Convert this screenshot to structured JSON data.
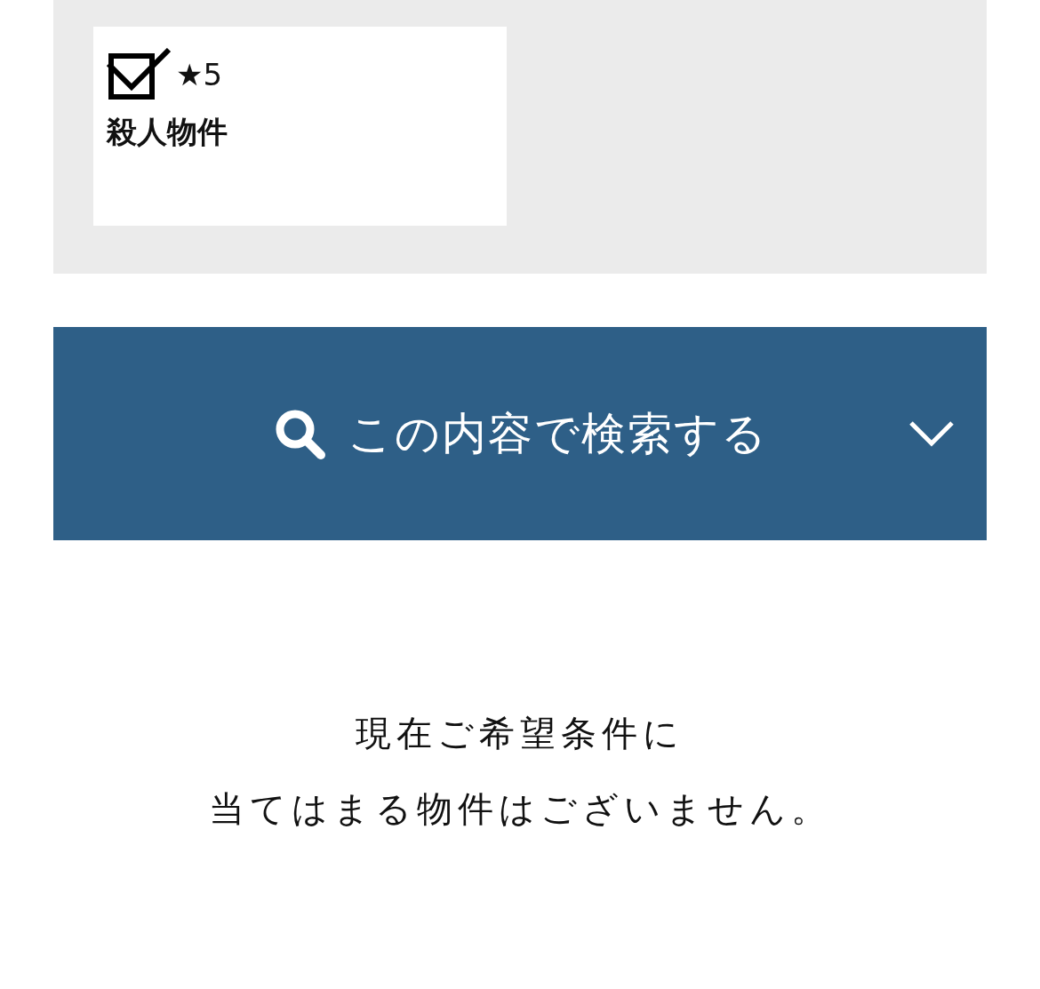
{
  "filters": [
    {
      "checked": true,
      "rating": "★5",
      "label": "殺人物件"
    }
  ],
  "search_button": {
    "label": "この内容で検索する"
  },
  "message": [
    "現在ご希望条件に",
    "当てはまる物件はございません。"
  ]
}
